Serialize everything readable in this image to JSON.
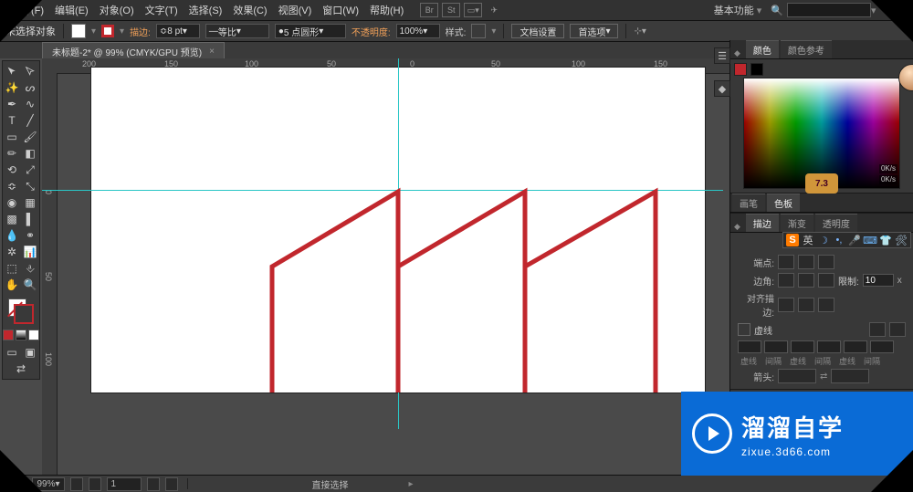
{
  "menu": {
    "items": [
      "文件(F)",
      "编辑(E)",
      "对象(O)",
      "文字(T)",
      "选择(S)",
      "效果(C)",
      "视图(V)",
      "窗口(W)",
      "帮助(H)"
    ],
    "bracket1": "Br",
    "bracket2": "St",
    "workspace_label": "基本功能"
  },
  "options": {
    "no_selection": "未选择对象",
    "stroke_label": "描边:",
    "stroke_weight": "8 pt",
    "uniform": "等比",
    "profile": "5 点圆形",
    "opacity_label": "不透明度:",
    "opacity": "100%",
    "style_label": "样式:",
    "doc_setup": "文档设置",
    "prefs": "首选项"
  },
  "tab": {
    "title": "未标题-2* @ 99% (CMYK/GPU 预览)"
  },
  "ruler_top": [
    "200",
    "150",
    "100",
    "50",
    "0",
    "50",
    "100",
    "150"
  ],
  "ruler_left": [
    "0",
    "50",
    "100"
  ],
  "status": {
    "zoom": "99%",
    "page": "1",
    "tool": "直接选择"
  },
  "panels": {
    "color_tabs": [
      "颜色",
      "颜色参考"
    ],
    "badge": "7.3",
    "spec_chip": "0K/s",
    "brush_tabs": [
      "画笔",
      "色板"
    ],
    "stroke_tabs": [
      "描边",
      "渐变",
      "透明度"
    ],
    "ime": [
      "S",
      "英"
    ],
    "cap_label": "端点:",
    "corner_label": "边角:",
    "limit_label": "限制:",
    "limit_value": "10",
    "limit_unit": "x",
    "align_label": "对齐描边:",
    "dash_label": "虚线",
    "dash_heads": [
      "虚线",
      "间隔",
      "虚线",
      "间隔",
      "虚线",
      "间隔"
    ],
    "arrow_label": "箭头:"
  },
  "logo": {
    "title": "溜溜自学",
    "sub": "zixue.3d66.com"
  }
}
